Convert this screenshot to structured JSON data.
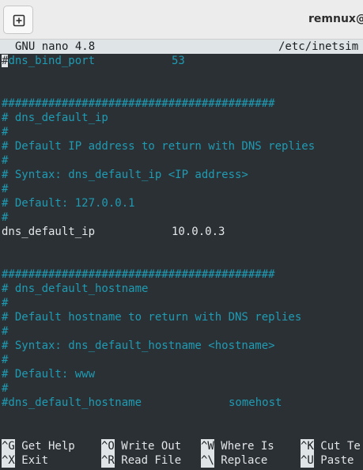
{
  "window": {
    "title": "remnux@r"
  },
  "nano": {
    "version": "GNU nano 4.8",
    "filename": "/etc/inetsim"
  },
  "editor": {
    "lines": [
      {
        "key": "#dns_bind_port",
        "value": "53",
        "type": "comment"
      },
      {
        "text": "",
        "type": "blank"
      },
      {
        "text": "",
        "type": "blank"
      },
      {
        "text": "#########################################",
        "type": "comment"
      },
      {
        "text": "# dns_default_ip",
        "type": "comment"
      },
      {
        "text": "#",
        "type": "comment"
      },
      {
        "text": "# Default IP address to return with DNS replies",
        "type": "comment"
      },
      {
        "text": "#",
        "type": "comment"
      },
      {
        "text": "# Syntax: dns_default_ip <IP address>",
        "type": "comment"
      },
      {
        "text": "#",
        "type": "comment"
      },
      {
        "text": "# Default: 127.0.0.1",
        "type": "comment"
      },
      {
        "text": "#",
        "type": "comment"
      },
      {
        "key": "dns_default_ip",
        "value": "10.0.0.3",
        "type": "setting"
      },
      {
        "text": "",
        "type": "blank"
      },
      {
        "text": "",
        "type": "blank"
      },
      {
        "text": "#########################################",
        "type": "comment"
      },
      {
        "text": "# dns_default_hostname",
        "type": "comment"
      },
      {
        "text": "#",
        "type": "comment"
      },
      {
        "text": "# Default hostname to return with DNS replies",
        "type": "comment"
      },
      {
        "text": "#",
        "type": "comment"
      },
      {
        "text": "# Syntax: dns_default_hostname <hostname>",
        "type": "comment"
      },
      {
        "text": "#",
        "type": "comment"
      },
      {
        "text": "# Default: www",
        "type": "comment"
      },
      {
        "text": "#",
        "type": "comment"
      },
      {
        "key": "#dns_default_hostname",
        "value": "somehost",
        "type": "comment"
      }
    ]
  },
  "shortcuts": {
    "row1": [
      {
        "key": "^G",
        "label": "Get Help"
      },
      {
        "key": "^O",
        "label": "Write Out"
      },
      {
        "key": "^W",
        "label": "Where Is"
      },
      {
        "key": "^K",
        "label": "Cut Te"
      }
    ],
    "row2": [
      {
        "key": "^X",
        "label": "Exit"
      },
      {
        "key": "^R",
        "label": "Read File"
      },
      {
        "key": "^\\",
        "label": "Replace"
      },
      {
        "key": "^U",
        "label": "Paste"
      }
    ]
  }
}
